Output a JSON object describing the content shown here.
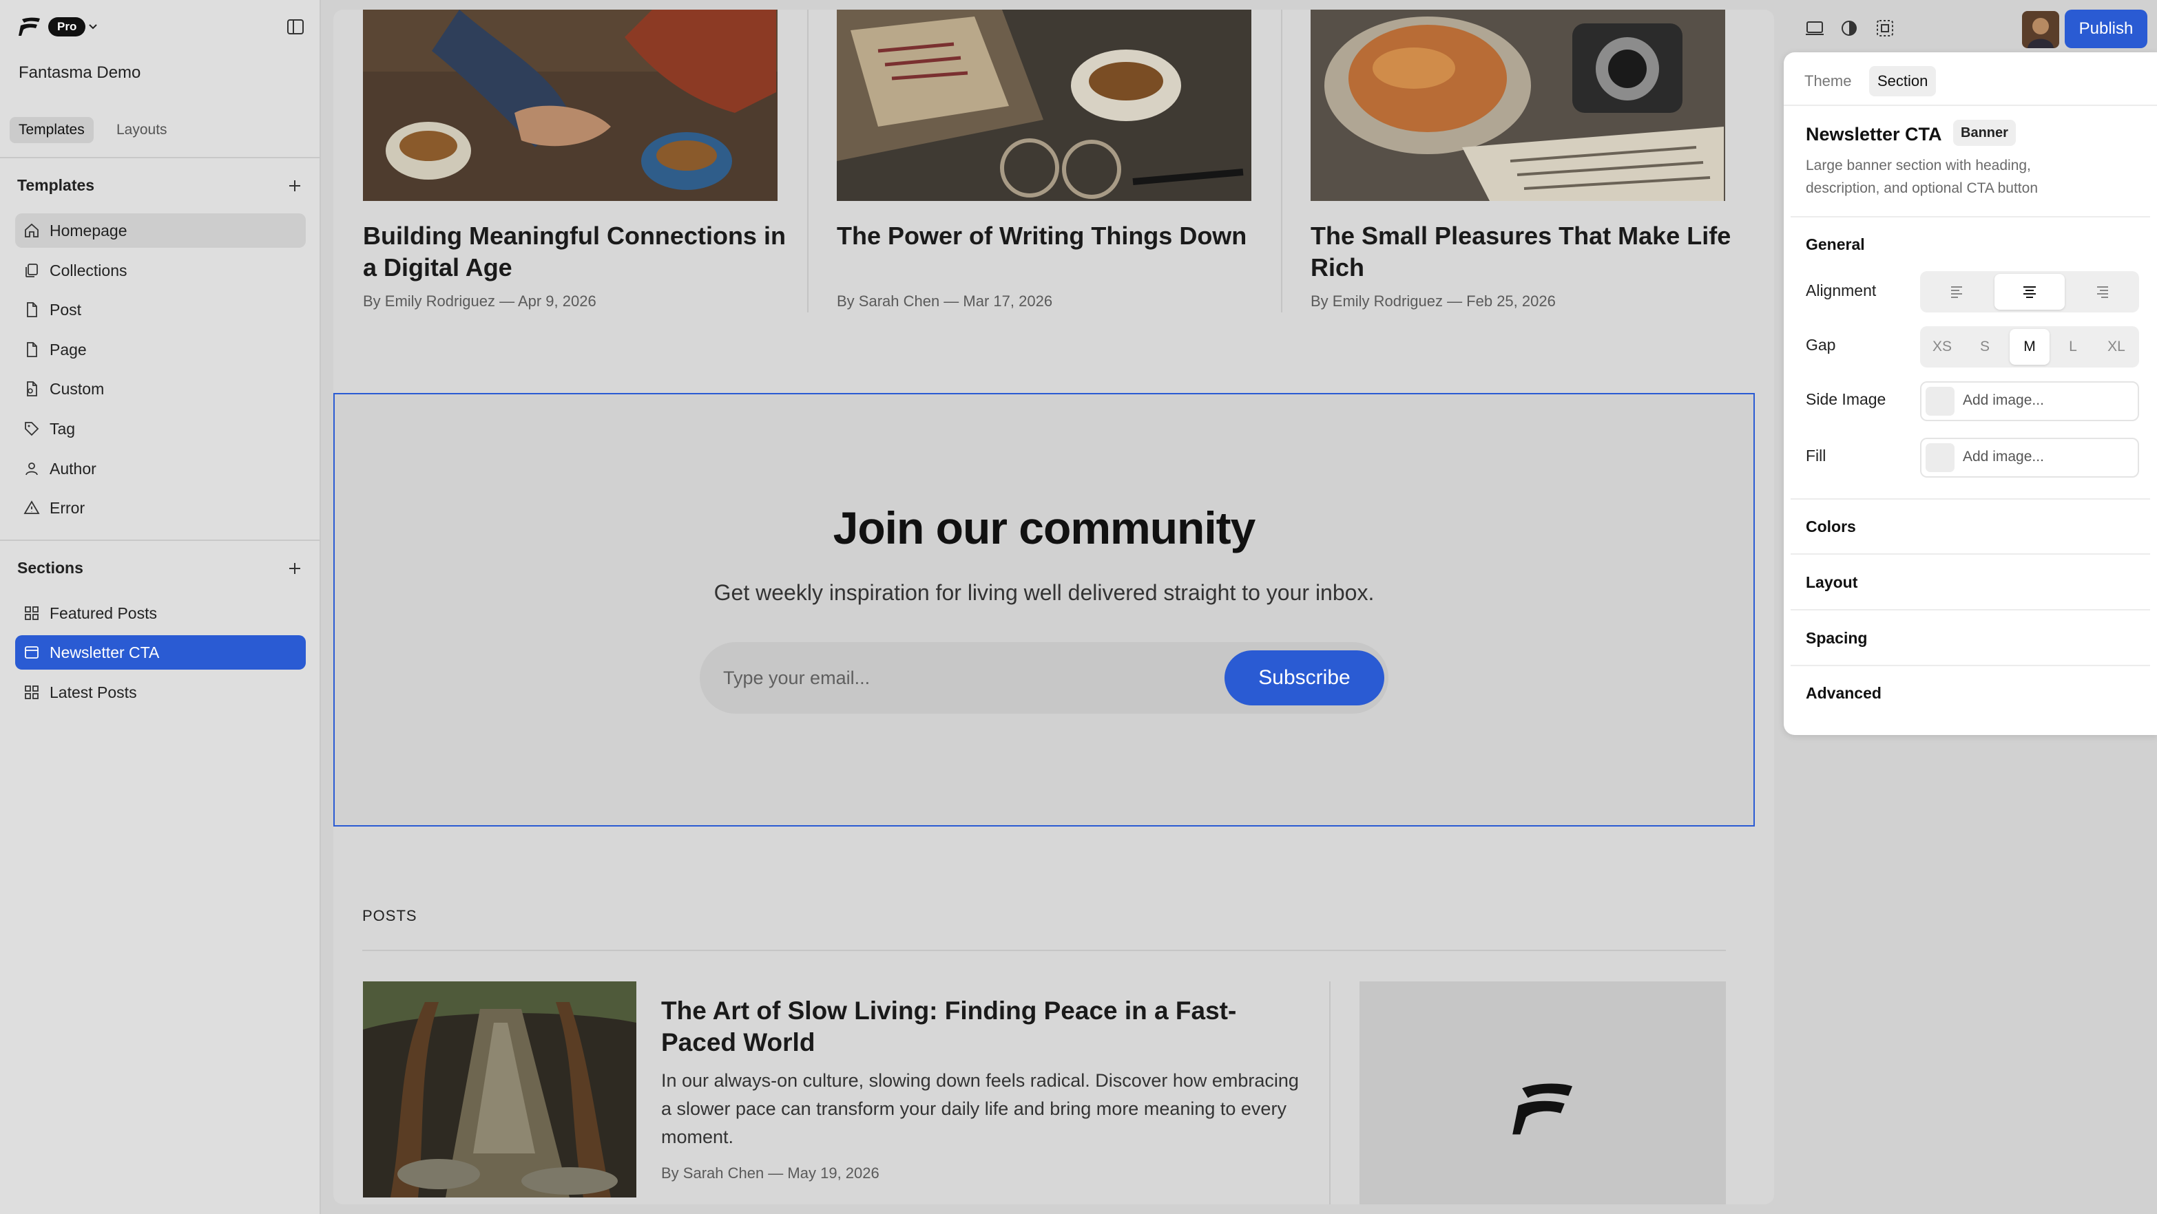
{
  "app": {
    "plan_badge": "Pro",
    "project_name": "Fantasma Demo"
  },
  "sidebar": {
    "tabs": [
      {
        "label": "Templates",
        "active": true
      },
      {
        "label": "Layouts",
        "active": false
      }
    ],
    "templates_heading": "Templates",
    "templates": [
      {
        "label": "Homepage",
        "icon": "home-icon"
      },
      {
        "label": "Collections",
        "icon": "stack-icon"
      },
      {
        "label": "Post",
        "icon": "file-icon"
      },
      {
        "label": "Page",
        "icon": "file-icon"
      },
      {
        "label": "Custom",
        "icon": "file-code-icon"
      },
      {
        "label": "Tag",
        "icon": "tag-icon"
      },
      {
        "label": "Author",
        "icon": "user-icon"
      },
      {
        "label": "Error",
        "icon": "warning-icon"
      }
    ],
    "sections_heading": "Sections",
    "sections": [
      {
        "label": "Featured Posts",
        "icon": "grid-icon"
      },
      {
        "label": "Newsletter CTA",
        "icon": "banner-icon",
        "selected": true
      },
      {
        "label": "Latest Posts",
        "icon": "grid-icon"
      }
    ]
  },
  "canvas": {
    "featured_cards": [
      {
        "title": "Building Meaningful Connections in a Digital Age",
        "meta": "By Emily Rodriguez — Apr 9, 2026"
      },
      {
        "title": "The Power of Writing Things Down",
        "meta": "By Sarah Chen — Mar 17, 2026"
      },
      {
        "title": "The Small Pleasures That Make Life Rich",
        "meta": "By Emily Rodriguez — Feb 25, 2026"
      }
    ],
    "cta": {
      "heading": "Join our community",
      "description": "Get weekly inspiration for living well delivered straight to your inbox.",
      "email_placeholder": "Type your email...",
      "button_label": "Subscribe"
    },
    "posts_section_label": "POSTS",
    "latest_post": {
      "title": "The Art of Slow Living: Finding Peace in a Fast-Paced World",
      "excerpt": "In our always-on culture, slowing down feels radical. Discover how embracing a slower pace can transform your daily life and bring more meaning to every moment.",
      "meta": "By Sarah Chen — May 19, 2026"
    }
  },
  "toolbar": {
    "icons": [
      "device-preview-icon",
      "contrast-icon",
      "selection-icon"
    ],
    "publish_label": "Publish"
  },
  "panel": {
    "tabs": [
      {
        "label": "Theme",
        "active": false
      },
      {
        "label": "Section",
        "active": true
      }
    ],
    "section_title": "Newsletter CTA",
    "section_badge": "Banner",
    "section_description": "Large banner section with heading, description, and optional CTA button",
    "general_heading": "General",
    "alignment_label": "Alignment",
    "alignment_options": [
      "left",
      "center",
      "right"
    ],
    "alignment_selected": "center",
    "gap_label": "Gap",
    "gap_options": [
      "XS",
      "S",
      "M",
      "L",
      "XL"
    ],
    "gap_selected": "M",
    "side_image_label": "Side Image",
    "side_image_placeholder": "Add image...",
    "fill_label": "Fill",
    "fill_placeholder": "Add image...",
    "groups": [
      "Colors",
      "Layout",
      "Spacing",
      "Advanced"
    ]
  },
  "colors": {
    "accent": "#2a5bd3",
    "overlay_gray": "#d1d1d1"
  }
}
